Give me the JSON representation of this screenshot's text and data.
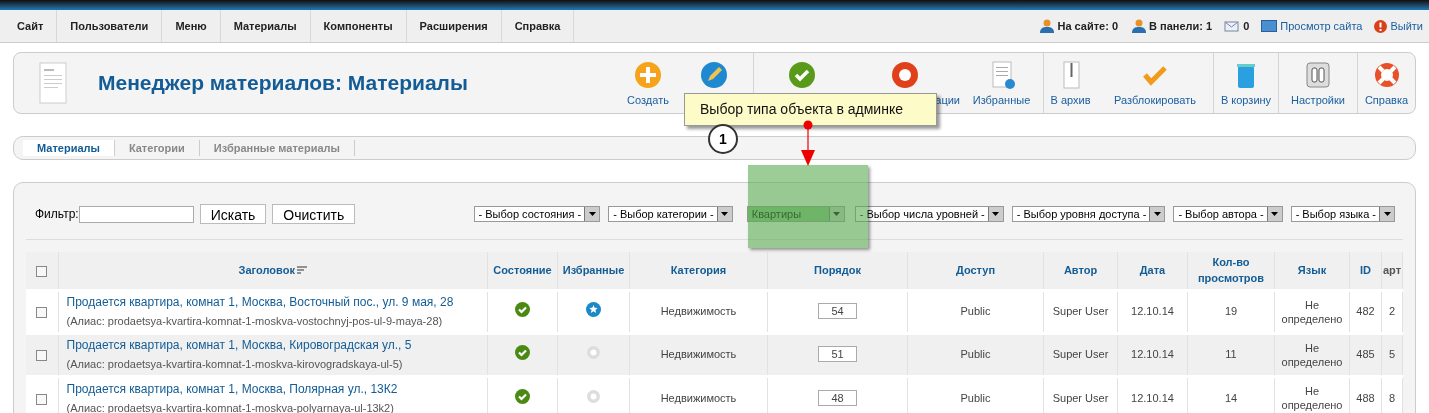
{
  "menu": [
    {
      "label": "Сайт"
    },
    {
      "label": "Пользователи"
    },
    {
      "label": "Меню"
    },
    {
      "label": "Материалы"
    },
    {
      "label": "Компоненты"
    },
    {
      "label": "Расширения"
    },
    {
      "label": "Справка"
    }
  ],
  "status": [
    {
      "kind": "users",
      "label": "На сайте: 0"
    },
    {
      "kind": "users",
      "label": "В панели: 1"
    },
    {
      "kind": "mail",
      "label": "0"
    },
    {
      "kind": "screen",
      "label": "Просмотр сайта"
    },
    {
      "kind": "logout",
      "label": "Выйти"
    }
  ],
  "page_title": "Менеджер материалов: Материалы",
  "toolbar": [
    {
      "kind": "new",
      "label": "Создать"
    },
    {
      "kind": "edit"
    },
    {
      "kind": "publish"
    },
    {
      "kind": "unpublish",
      "label": "ации"
    },
    {
      "kind": "featured",
      "label": "Избранные"
    },
    {
      "kind": "archive",
      "label": "В архив"
    },
    {
      "kind": "checkin",
      "label": "Разблокировать"
    },
    {
      "kind": "trash",
      "label": "В корзину"
    },
    {
      "kind": "options",
      "label": "Настройки"
    },
    {
      "kind": "help",
      "label": "Справка"
    }
  ],
  "tabs": [
    {
      "label": "Материалы",
      "selected": true
    },
    {
      "label": "Категории",
      "selected": false
    },
    {
      "label": "Избранные материалы",
      "selected": false
    }
  ],
  "filter": {
    "label": "Фильтр:",
    "search_button": "Искать",
    "clear_button": "Очистить"
  },
  "selects": [
    {
      "value": "- Выбор состояния -"
    },
    {
      "value": "- Выбор категории -"
    },
    {
      "value": "Квартиры"
    },
    {
      "value": "- Выбор числа уровней -"
    },
    {
      "value": "- Выбор уровня доступа -"
    },
    {
      "value": "- Выбор автора -"
    },
    {
      "value": "- Выбор языка -"
    }
  ],
  "table": {
    "select_all_checked": false,
    "columns": [
      "Заголовок",
      "Состояние",
      "Избранные",
      "Категория",
      "Порядок",
      "Доступ",
      "Автор",
      "Дата",
      "Кол-во просмотров",
      "Язык",
      "ID",
      "арт"
    ],
    "rows": [
      {
        "title": "Продается квартира, комнат 1, Москва, Восточный пос., ул. 9 мая, 28",
        "checked": false,
        "alias": "(Алиас: prodaetsya-kvartira-komnat-1-moskva-vostochnyj-pos-ul-9-maya-28)",
        "published": true,
        "featured": true,
        "category": "Недвижимость",
        "order": "54",
        "access": "Public",
        "author": "Super User",
        "date": "12.10.14",
        "views": "19",
        "language": "Не определено",
        "id": "482",
        "column_12": "2"
      },
      {
        "title": "Продается квартира, комнат 1, Москва, Кировоградская ул., 5",
        "checked": false,
        "alias": "(Алиас: prodaetsya-kvartira-komnat-1-moskva-kirovogradskaya-ul-5)",
        "published": true,
        "featured": false,
        "category": "Недвижимость",
        "order": "51",
        "access": "Public",
        "author": "Super User",
        "date": "12.10.14",
        "views": "11",
        "language": "Не определено",
        "id": "485",
        "column_12": "5"
      },
      {
        "title": "Продается квартира, комнат 1, Москва, Полярная ул., 13К2",
        "checked": false,
        "alias": "(Алиас: prodaetsya-kvartira-komnat-1-moskva-polyarnaya-ul-13k2)",
        "published": true,
        "featured": false,
        "category": "Недвижимость",
        "order": "48",
        "access": "Public",
        "author": "Super User",
        "date": "12.10.14",
        "views": "14",
        "language": "Не определено",
        "id": "488",
        "column_12": "8"
      }
    ]
  },
  "annotation": {
    "callout": "Выбор типа объекта в админке",
    "number": "1"
  }
}
